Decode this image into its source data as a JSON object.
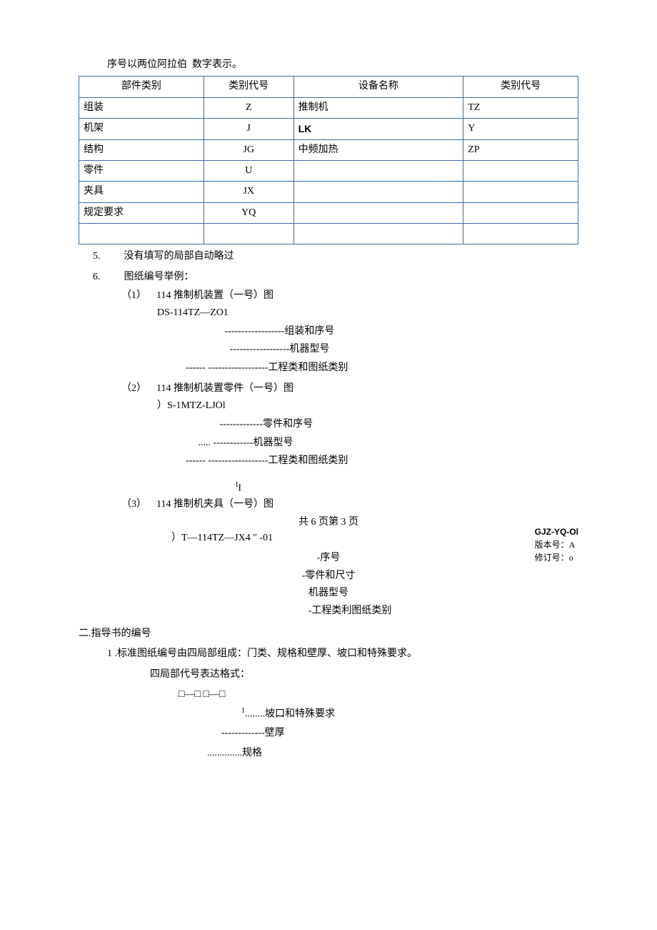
{
  "line1_a": "序号以两位阿拉伯",
  "line1_b": "数字表示。",
  "table": {
    "headers": [
      "部件类别",
      "类别代号",
      "设备名称",
      "类别代号"
    ],
    "rows": [
      [
        "组装",
        "Z",
        "推制机",
        "TZ"
      ],
      [
        "机架",
        "J",
        "LK",
        "Y"
      ],
      [
        "结构",
        "JG",
        "中频加热",
        "ZP"
      ],
      [
        "零件",
        "U",
        "",
        ""
      ],
      [
        "夹具",
        "JX",
        "",
        ""
      ],
      [
        "规定要求",
        "YQ",
        "",
        ""
      ],
      [
        "",
        "",
        "",
        ""
      ]
    ]
  },
  "item5_num": "5.",
  "item5_text": "没有填写的局部自动略过",
  "item6_num": "6.",
  "item6_text": "图纸编号举例：",
  "ex1_num": "（1）",
  "ex1_title": "114 推制机装置（一号）图",
  "ex1_code": "DS-114TZ—ZO1",
  "ex1_d1": "------------------组装和序号",
  "ex1_d2": "------------------机器型号",
  "ex1_d3": "------ ------------------工程类和图纸类别",
  "ex2_num": "（2）",
  "ex2_title": "114 推制机装置零件（一号）图",
  "ex2_code": "）S-1MTZ-LJOl",
  "ex2_d1": "-------------零件和序号",
  "ex2_d2": "..... ------------机器型号",
  "ex2_d3": "------ ------------------工程类和图纸类别",
  "hbox_gjz": "GJZ-YQ-Ol",
  "hbox_ver": "版本号：A",
  "hbox_rev": "修订号：o",
  "iI": "I",
  "iI_sub": "I",
  "ex3_num": "（3）",
  "ex3_title": "114 推制机夹具（一号）图",
  "pageinfo": "共 6 页第 3 页",
  "ex3_code": "）T—114TZ—JX4 ″ -01",
  "ex3_d1": "-序号",
  "ex3_d2": "-零件和尺寸",
  "ex3_d3": "机器型号",
  "ex3_d4": "-工程类利图纸类别",
  "sec2_h": "二.指导书的编号",
  "sec2_1": "1 .标准图纸编号由四局部组成：门类、规格和壁厚、坡口和特殊要求。",
  "sec2_2": "四局部代号表达格式：",
  "sec2_boxes": "□—□ □—□",
  "sec2_d1_sup": "1",
  "sec2_d1": "........坡口和特殊要求",
  "sec2_d2": "-------------壁厚",
  "sec2_d3": "..............规格"
}
